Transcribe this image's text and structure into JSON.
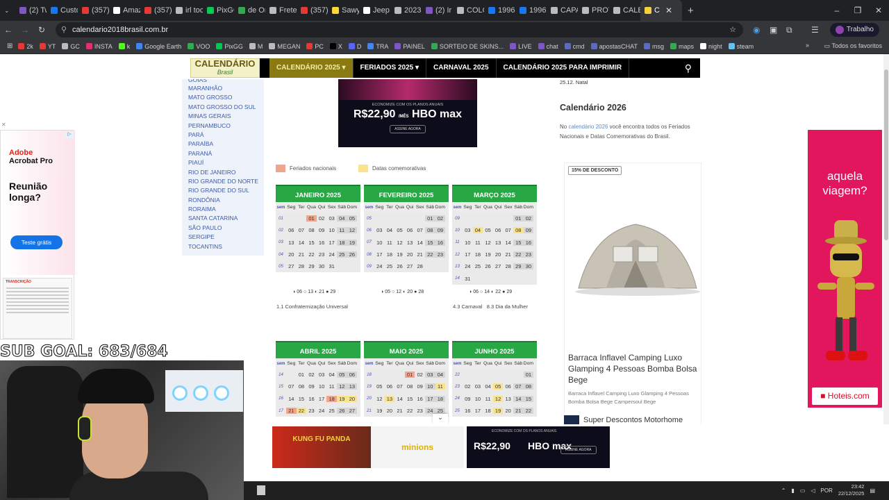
{
  "browser": {
    "tabs": [
      {
        "label": "(2) Tw",
        "color": "#7e57c2"
      },
      {
        "label": "Custo",
        "color": "#1877f2"
      },
      {
        "label": "(357)",
        "color": "#e53935"
      },
      {
        "label": "Amaz",
        "color": "#ffffff"
      },
      {
        "label": "(357)",
        "color": "#e53935"
      },
      {
        "label": "irl toc",
        "color": "#bbbbbb"
      },
      {
        "label": "PixGG",
        "color": "#00c853"
      },
      {
        "label": "de Or",
        "color": "#34a853"
      },
      {
        "label": "Frete",
        "color": "#bbbbbb"
      },
      {
        "label": "(357)",
        "color": "#e53935"
      },
      {
        "label": "Sawy",
        "color": "#fdd835"
      },
      {
        "label": "Jeep",
        "color": "#ffffff"
      },
      {
        "label": "2023",
        "color": "#bbbbbb"
      },
      {
        "label": "(2) Ir",
        "color": "#7e57c2"
      },
      {
        "label": "COLO",
        "color": "#bbbbbb"
      },
      {
        "label": "1996",
        "color": "#1877f2"
      },
      {
        "label": "1996",
        "color": "#1877f2"
      },
      {
        "label": "CAPA",
        "color": "#bbbbbb"
      },
      {
        "label": "PROT",
        "color": "#bbbbbb"
      },
      {
        "label": "CALE",
        "color": "#bbbbbb"
      },
      {
        "label": "C",
        "color": "#f4d03f",
        "active": true
      }
    ],
    "url": "calendario2018brasil.com.br",
    "profile": "Trabalho",
    "bookmarks": [
      {
        "label": "2k",
        "color": "#e53935"
      },
      {
        "label": "YT",
        "color": "#e53935"
      },
      {
        "label": "GC",
        "color": "#bbbbbb"
      },
      {
        "label": "INSTA",
        "color": "#e1306c"
      },
      {
        "label": "k",
        "color": "#53fc18"
      },
      {
        "label": "Google Earth",
        "color": "#4285f4"
      },
      {
        "label": "VOO",
        "color": "#34a853"
      },
      {
        "label": "PixGG",
        "color": "#00c853"
      },
      {
        "label": "M",
        "color": "#bbbbbb"
      },
      {
        "label": "MEGAN",
        "color": "#bbbbbb"
      },
      {
        "label": "PC",
        "color": "#e53935"
      },
      {
        "label": "X",
        "color": "#000000"
      },
      {
        "label": "D",
        "color": "#5865f2"
      },
      {
        "label": "TRA",
        "color": "#4285f4"
      },
      {
        "label": "PAINEL",
        "color": "#7e57c2"
      },
      {
        "label": "SORTEIO DE SKINS...",
        "color": "#34a853"
      },
      {
        "label": "LIVE",
        "color": "#7e57c2"
      },
      {
        "label": "chat",
        "color": "#7e57c2"
      },
      {
        "label": "cmd",
        "color": "#5c6bc0"
      },
      {
        "label": "apostasCHAT",
        "color": "#5c6bc0"
      },
      {
        "label": "msg",
        "color": "#5c6bc0"
      },
      {
        "label": "maps",
        "color": "#34a853"
      },
      {
        "label": "night",
        "color": "#ffffff"
      },
      {
        "label": "steam",
        "color": "#66c0f4"
      }
    ],
    "all_favorites": "Todos os favoritos"
  },
  "site": {
    "logo_title": "CALENDÁRIO",
    "logo_sub": "Brasil",
    "nav": [
      {
        "label": "CALENDÁRIO 2025",
        "chevron": true,
        "active": true
      },
      {
        "label": "FERIADOS 2025",
        "chevron": true,
        "active": false
      },
      {
        "label": "CARNAVAL 2025",
        "chevron": false,
        "active": false
      },
      {
        "label": "CALENDÁRIO 2025 PARA IMPRIMIR",
        "chevron": false,
        "active": false
      }
    ],
    "states": [
      "GOIÁS",
      "MARANHÃO",
      "MATO GROSSO",
      "MATO GROSSO DO SUL",
      "MINAS GERAIS",
      "PERNAMBUCO",
      "PARÁ",
      "PARAÍBA",
      "PARANÁ",
      "PIAUÍ",
      "RIO DE JANEIRO",
      "RIO GRANDE DO NORTE",
      "RIO GRANDE DO SUL",
      "RONDÔNIA",
      "RORAIMA",
      "SANTA CATARINA",
      "SÃO PAULO",
      "SERGIPE",
      "TOCANTINS"
    ],
    "legend": [
      {
        "label": "Feriados nacionais",
        "color": "#f2a58c"
      },
      {
        "label": "Datas comemorativas",
        "color": "#f9e48d"
      }
    ],
    "week_header": [
      "sem",
      "Seg",
      "Ter",
      "Qua",
      "Qui",
      "Sex",
      "Sáb",
      "Dom"
    ],
    "months": [
      {
        "title": "JANEIRO 2025",
        "weeks": [
          [
            "01",
            "",
            "",
            "01",
            "02",
            "03",
            "04",
            "05"
          ],
          [
            "02",
            "06",
            "07",
            "08",
            "09",
            "10",
            "11",
            "12"
          ],
          [
            "03",
            "13",
            "14",
            "15",
            "16",
            "17",
            "18",
            "19"
          ],
          [
            "04",
            "20",
            "21",
            "22",
            "23",
            "24",
            "25",
            "26"
          ],
          [
            "05",
            "27",
            "28",
            "29",
            "30",
            "31",
            "",
            ""
          ]
        ],
        "holidays": [
          "01"
        ],
        "commemorative": [],
        "moons": [
          "06",
          "13",
          "21",
          "29"
        ],
        "notes": "1.1 Confraternização Universal"
      },
      {
        "title": "FEVEREIRO 2025",
        "weeks": [
          [
            "05",
            "",
            "",
            "",
            "",
            "",
            "01",
            "02"
          ],
          [
            "06",
            "03",
            "04",
            "05",
            "06",
            "07",
            "08",
            "09"
          ],
          [
            "07",
            "10",
            "11",
            "12",
            "13",
            "14",
            "15",
            "16"
          ],
          [
            "08",
            "17",
            "18",
            "19",
            "20",
            "21",
            "22",
            "23"
          ],
          [
            "09",
            "24",
            "25",
            "26",
            "27",
            "28",
            "",
            ""
          ]
        ],
        "holidays": [],
        "commemorative": [],
        "moons": [
          "05",
          "12",
          "20",
          "28"
        ],
        "notes": ""
      },
      {
        "title": "MARÇO 2025",
        "weeks": [
          [
            "09",
            "",
            "",
            "",
            "",
            "",
            "01",
            "02"
          ],
          [
            "10",
            "03",
            "04",
            "05",
            "06",
            "07",
            "08",
            "09"
          ],
          [
            "11",
            "10",
            "11",
            "12",
            "13",
            "14",
            "15",
            "16"
          ],
          [
            "12",
            "17",
            "18",
            "19",
            "20",
            "21",
            "22",
            "23"
          ],
          [
            "13",
            "24",
            "25",
            "26",
            "27",
            "28",
            "29",
            "30"
          ],
          [
            "14",
            "31",
            "",
            "",
            "",
            "",
            "",
            ""
          ]
        ],
        "holidays": [],
        "commemorative": [
          "04",
          "08"
        ],
        "moons": [
          "06",
          "14",
          "22",
          "29"
        ],
        "notes": "4.3 Carnaval   8.3 Dia da Mulher"
      },
      {
        "title": "ABRIL 2025",
        "weeks": [
          [
            "14",
            "",
            "01",
            "02",
            "03",
            "04",
            "05",
            "06"
          ],
          [
            "15",
            "07",
            "08",
            "09",
            "10",
            "11",
            "12",
            "13"
          ],
          [
            "16",
            "14",
            "15",
            "16",
            "17",
            "18",
            "19",
            "20"
          ],
          [
            "17",
            "21",
            "22",
            "23",
            "24",
            "25",
            "26",
            "27"
          ]
        ],
        "holidays": [
          "18",
          "21"
        ],
        "commemorative": [
          "19",
          "20",
          "22"
        ],
        "moons": [],
        "notes": ""
      },
      {
        "title": "MAIO 2025",
        "weeks": [
          [
            "18",
            "",
            "",
            "",
            "01",
            "02",
            "03",
            "04"
          ],
          [
            "19",
            "05",
            "06",
            "07",
            "08",
            "09",
            "10",
            "11"
          ],
          [
            "20",
            "12",
            "13",
            "14",
            "15",
            "16",
            "17",
            "18"
          ],
          [
            "21",
            "19",
            "20",
            "21",
            "22",
            "23",
            "24",
            "25"
          ]
        ],
        "holidays": [
          "01"
        ],
        "commemorative": [
          "11",
          "13"
        ],
        "moons": [],
        "notes": ""
      },
      {
        "title": "JUNHO 2025",
        "weeks": [
          [
            "22",
            "",
            "",
            "",
            "",
            "",
            "",
            "01"
          ],
          [
            "23",
            "02",
            "03",
            "04",
            "05",
            "06",
            "07",
            "08"
          ],
          [
            "24",
            "09",
            "10",
            "11",
            "12",
            "13",
            "14",
            "15"
          ],
          [
            "25",
            "16",
            "17",
            "18",
            "19",
            "20",
            "21",
            "22"
          ]
        ],
        "holidays": [],
        "commemorative": [
          "05",
          "12",
          "19"
        ],
        "moons": [],
        "notes": ""
      }
    ],
    "natal": "25.12.  Natal",
    "cal2026_title": "Calendário 2026",
    "cal2026_pre": "No ",
    "cal2026_link": "calendário 2026",
    "cal2026_post": " você encontra todos os Feriados Nacionais e Datas Comemorativas do Brasil."
  },
  "ads": {
    "hbo_top": {
      "line": "ECONOMIZE COM OS PLANOS ANUAIS",
      "from": "A PARTIR DE",
      "price": "R$22,90",
      "per": "/MÊS",
      "brand": "HBO max",
      "button": "ASSINE AGORA"
    },
    "tent": {
      "discount": "15% DE DESCONTO",
      "title": "Barraca Inflavel Camping Luxo Glamping 4 Pessoas Bomba Bolsa Bege",
      "subtitle": "Barraca Inflavel Camping Luxo Glamping 4 Pessoas Bomba Bolsa Bege Campersoul Bege"
    },
    "motorhome": "Super Descontos Motorhome",
    "adobe": {
      "brand": "Adobe",
      "product": "Acrobat Pro",
      "question": "Reunião longa?",
      "button": "Teste grátis",
      "doc": "TRANSCRIÇÃO"
    },
    "hoteis": {
      "tagline": "aquela viagem?",
      "brand": "Hoteis.com"
    },
    "bottom": {
      "kfp": "KUNG FU PANDA",
      "minions": "minions",
      "hbo_line": "ECONOMIZE COM OS PLANOS ANUAIS",
      "hbo_price": "R$22,90",
      "hbo_brand": "HBO max",
      "hbo_button": "ASSINE AGORA"
    }
  },
  "stream": {
    "sub_goal": "SUB GOAL: 683/684"
  },
  "taskbar": {
    "lang": "POR",
    "time": "23:42",
    "date": "22/12/2025"
  }
}
